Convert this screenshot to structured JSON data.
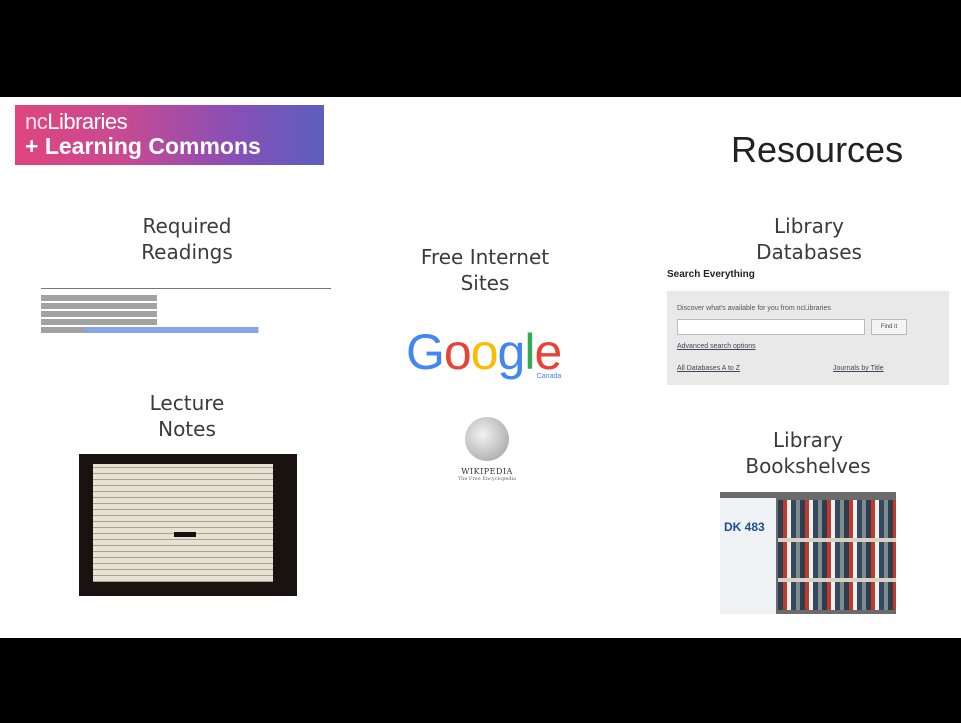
{
  "slide": {
    "logo": {
      "line1_prefix": "nc",
      "line1_main": "Libraries",
      "line2": "+ Learning Commons"
    },
    "title": "Resources",
    "headings": {
      "required_readings": [
        "Required",
        "Readings"
      ],
      "lecture_notes": [
        "Lecture",
        "Notes"
      ],
      "free_internet_sites": [
        "Free Internet",
        "Sites"
      ],
      "library_databases": [
        "Library",
        "Databases"
      ],
      "library_bookshelves": [
        "Library",
        "Bookshelves"
      ]
    },
    "google": {
      "letters": [
        "G",
        "o",
        "o",
        "g",
        "l",
        "e"
      ],
      "colors": [
        "#4285F4",
        "#EA4335",
        "#FBBC05",
        "#4285F4",
        "#34A853",
        "#EA4335"
      ],
      "sub": "Canada"
    },
    "wikipedia": {
      "name": "WIKIPEDIA",
      "tagline": "The Free Encyclopedia"
    },
    "database_search": {
      "label": "Search Everything",
      "description": "Discover what's available for you from ncLibraries",
      "button": "Find it",
      "advanced": "Advanced search options",
      "all_databases": "All Databases A to Z",
      "journals": "Journals by Title"
    },
    "bookshelf_sign": "DK 483"
  }
}
